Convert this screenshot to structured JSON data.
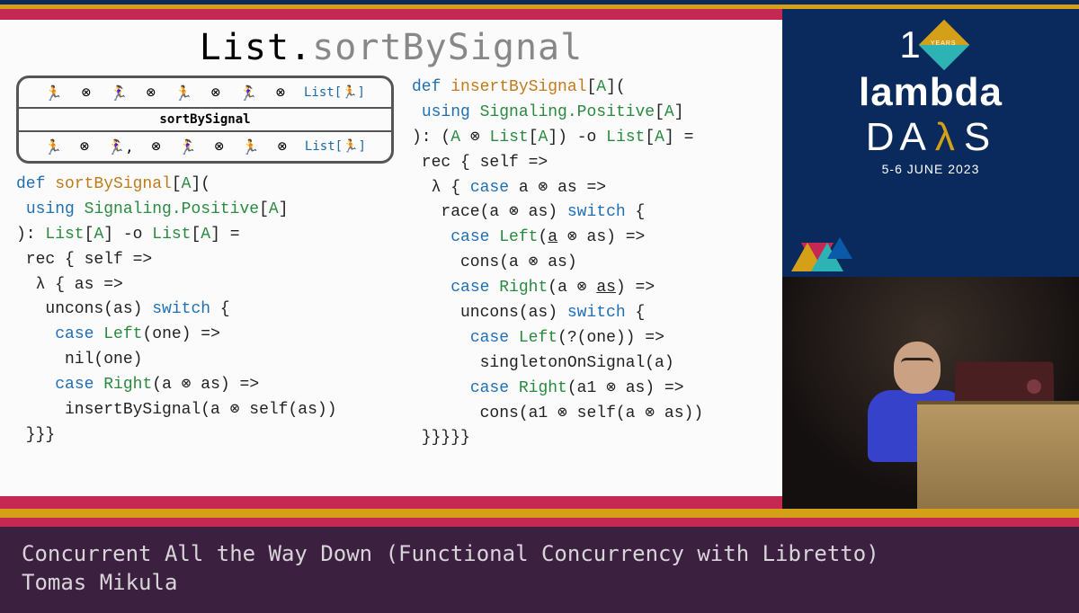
{
  "slide": {
    "title_prefix": "List.",
    "title_suffix": "sortBySignal",
    "diagram": {
      "mid_label": "sortBySignal",
      "list_label": "List[🏃‍]"
    },
    "code_left": "def sortBySignal[A](\n using Signaling.Positive[A]\n): List[A] -o List[A] =\n rec { self =>\n  λ { as =>\n   uncons(as) switch {\n    case Left(one) =>\n     nil(one)\n    case Right(a ⊗ as) =>\n     insertBySignal(a ⊗ self(as))\n }}}",
    "code_right": "def insertBySignal[A](\n using Signaling.Positive[A]\n): (A ⊗ List[A]) -o List[A] =\n rec { self =>\n  λ { case a ⊗ as =>\n   race(a ⊗ as) switch {\n    case Left(a ⊗ as) =>\n     cons(a ⊗ as)\n    case Right(a ⊗ as) =>\n     uncons(as) switch {\n      case Left(?(one)) =>\n       singletonOnSignal(a)\n      case Right(a1 ⊗ as) =>\n       cons(a1 ⊗ self(a ⊗ as))\n }}}}}"
  },
  "branding": {
    "years_badge": "YEARS",
    "word": "lambda",
    "days": "DA",
    "days_suffix": "S",
    "date": "5-6 JUNE 2023"
  },
  "caption": {
    "line1": "Concurrent All the Way Down (Functional Concurrency with Libretto)",
    "line2": "Tomas Mikula"
  }
}
